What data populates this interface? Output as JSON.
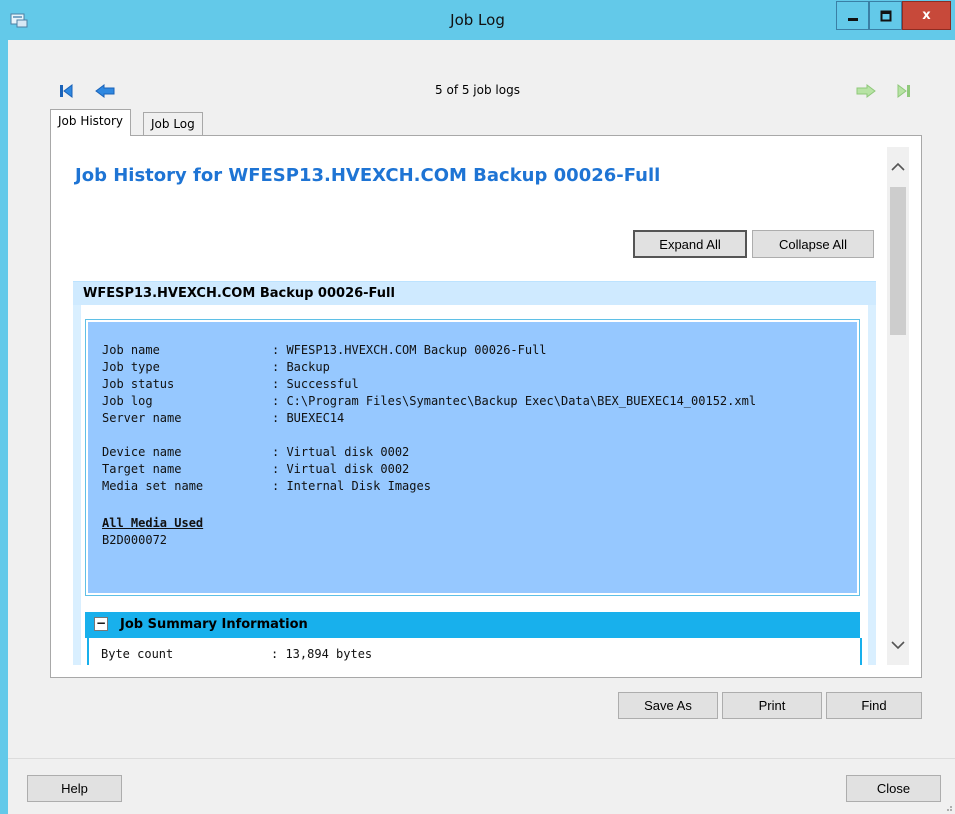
{
  "window": {
    "title": "Job Log",
    "close_glyph": "x"
  },
  "nav": {
    "count_text": "5 of 5 job logs",
    "icons": [
      "first-icon",
      "previous-icon",
      "next-icon",
      "last-icon"
    ]
  },
  "tabs": [
    {
      "label": "Job History",
      "active": true
    },
    {
      "label": "Job Log",
      "active": false
    }
  ],
  "content": {
    "title": "Job History for WFESP13.HVEXCH.COM Backup 00026-Full",
    "expand_all_label": "Expand All",
    "collapse_all_label": "Collapse All",
    "section_title": "WFESP13.HVEXCH.COM Backup 00026-Full",
    "details_group1": [
      {
        "key": "Job name",
        "value": ": WFESP13.HVEXCH.COM Backup 00026-Full"
      },
      {
        "key": "Job type",
        "value": ": Backup"
      },
      {
        "key": "Job status",
        "value": ": Successful"
      },
      {
        "key": "Job log",
        "value": ": C:\\Program Files\\Symantec\\Backup Exec\\Data\\BEX_BUEXEC14_00152.xml"
      },
      {
        "key": "Server name",
        "value": ": BUEXEC14"
      }
    ],
    "details_group2": [
      {
        "key": "Device name",
        "value": ": Virtual disk 0002"
      },
      {
        "key": "Target name",
        "value": ": Virtual disk 0002"
      },
      {
        "key": "Media set name",
        "value": ": Internal Disk Images"
      }
    ],
    "media_heading": "All Media Used",
    "media_value": "B2D000072",
    "summary_title": "Job Summary Information",
    "summary_toggle": "−",
    "summary_partial": {
      "key": "Byte count",
      "value": ": 13,894 bytes"
    }
  },
  "buttons": {
    "save_as": "Save As",
    "print": "Print",
    "find": "Find",
    "help": "Help",
    "close": "Close"
  },
  "colors": {
    "titlebar": "#63c9e9",
    "link_blue": "#1e74d4",
    "info_box": "#96c8ff",
    "summary_bar": "#18b0ec"
  }
}
